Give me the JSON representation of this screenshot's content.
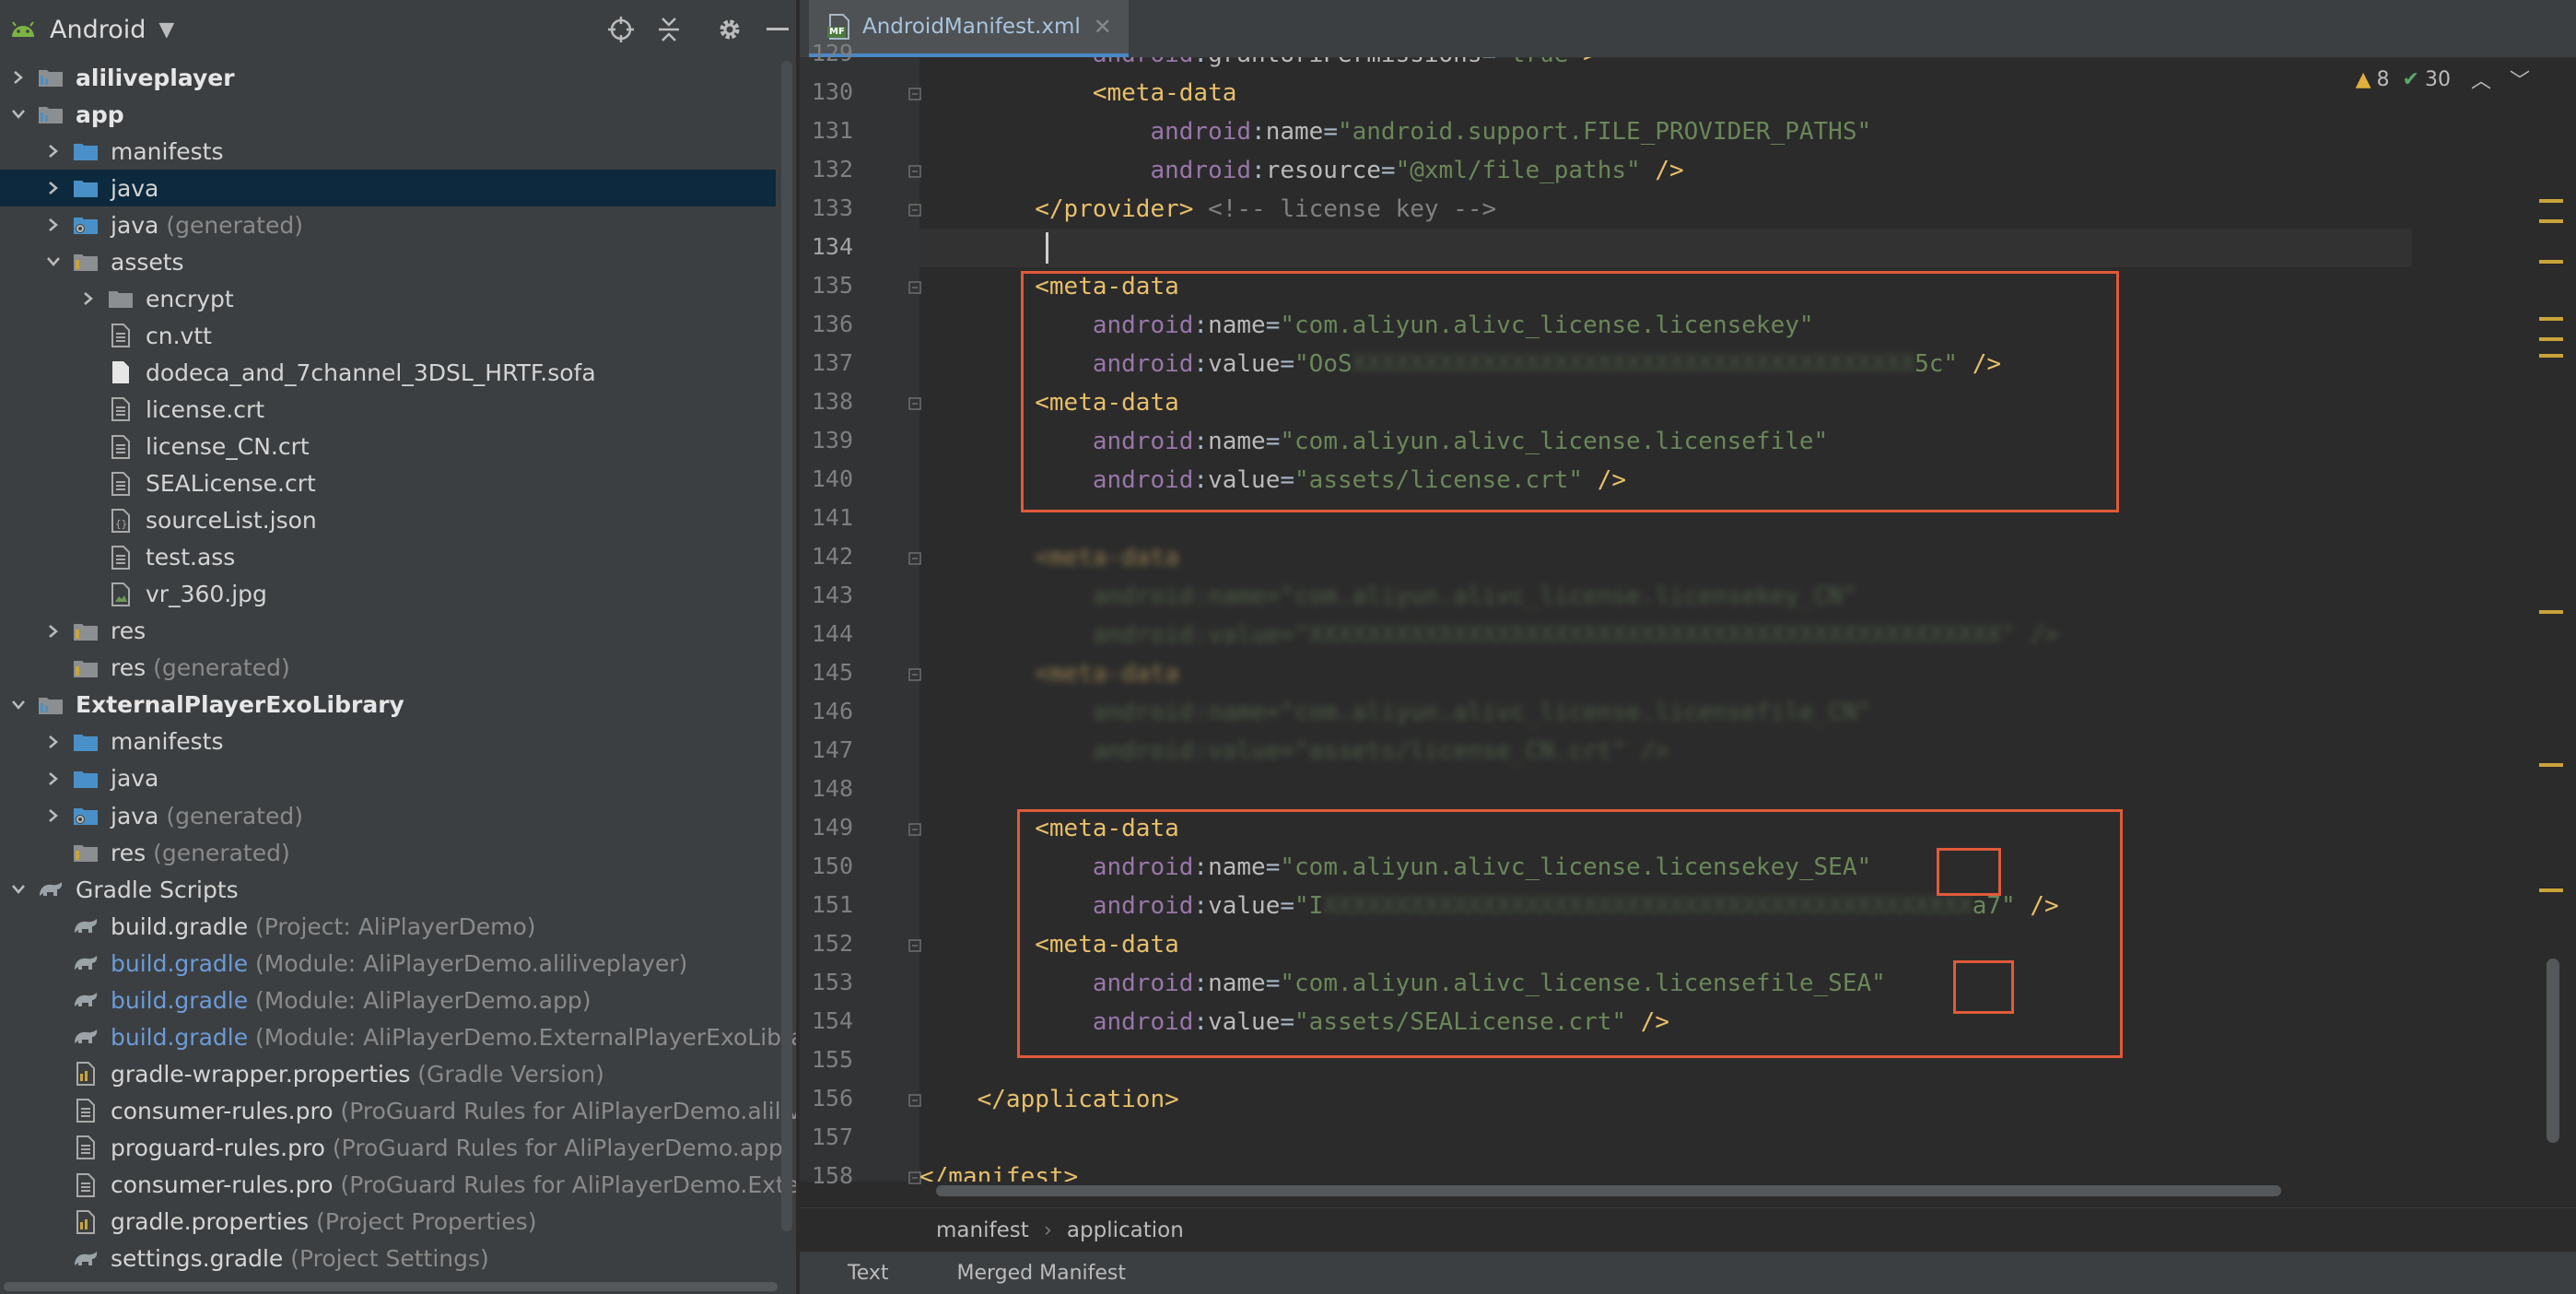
{
  "project_panel": {
    "title": "Android",
    "tree": [
      {
        "label": "aliliveplayer",
        "note": "",
        "depth": 0,
        "arrow": "right",
        "icon": "module-icon",
        "style": "bold"
      },
      {
        "label": "app",
        "note": "",
        "depth": 0,
        "arrow": "down",
        "icon": "module-icon",
        "style": "bold"
      },
      {
        "label": "manifests",
        "note": "",
        "depth": 1,
        "arrow": "right",
        "icon": "folder-blue-icon",
        "style": ""
      },
      {
        "label": "java",
        "note": "",
        "depth": 1,
        "arrow": "right",
        "icon": "folder-blue-icon",
        "style": "",
        "selected": true
      },
      {
        "label": "java",
        "note": "(generated)",
        "depth": 1,
        "arrow": "right",
        "icon": "folder-generated-icon",
        "style": ""
      },
      {
        "label": "assets",
        "note": "",
        "depth": 1,
        "arrow": "down",
        "icon": "folder-assets-icon",
        "style": ""
      },
      {
        "label": "encrypt",
        "note": "",
        "depth": 2,
        "arrow": "right",
        "icon": "folder-icon",
        "style": ""
      },
      {
        "label": "cn.vtt",
        "note": "",
        "depth": 2,
        "arrow": "",
        "icon": "text-file-icon",
        "style": ""
      },
      {
        "label": "dodeca_and_7channel_3DSL_HRTF.sofa",
        "note": "",
        "depth": 2,
        "arrow": "",
        "icon": "blank-file-icon",
        "style": ""
      },
      {
        "label": "license.crt",
        "note": "",
        "depth": 2,
        "arrow": "",
        "icon": "text-file-icon",
        "style": ""
      },
      {
        "label": "license_CN.crt",
        "note": "",
        "depth": 2,
        "arrow": "",
        "icon": "text-file-icon",
        "style": ""
      },
      {
        "label": "SEALicense.crt",
        "note": "",
        "depth": 2,
        "arrow": "",
        "icon": "text-file-icon",
        "style": ""
      },
      {
        "label": "sourceList.json",
        "note": "",
        "depth": 2,
        "arrow": "",
        "icon": "json-file-icon",
        "style": ""
      },
      {
        "label": "test.ass",
        "note": "",
        "depth": 2,
        "arrow": "",
        "icon": "text-file-icon",
        "style": ""
      },
      {
        "label": "vr_360.jpg",
        "note": "",
        "depth": 2,
        "arrow": "",
        "icon": "image-file-icon",
        "style": ""
      },
      {
        "label": "res",
        "note": "",
        "depth": 1,
        "arrow": "right",
        "icon": "folder-res-icon",
        "style": ""
      },
      {
        "label": "res",
        "note": "(generated)",
        "depth": 1,
        "arrow": "",
        "icon": "folder-res-icon",
        "style": ""
      },
      {
        "label": "ExternalPlayerExoLibrary",
        "note": "",
        "depth": 0,
        "arrow": "down",
        "icon": "module-icon",
        "style": "bold"
      },
      {
        "label": "manifests",
        "note": "",
        "depth": 1,
        "arrow": "right",
        "icon": "folder-blue-icon",
        "style": ""
      },
      {
        "label": "java",
        "note": "",
        "depth": 1,
        "arrow": "right",
        "icon": "folder-blue-icon",
        "style": ""
      },
      {
        "label": "java",
        "note": "(generated)",
        "depth": 1,
        "arrow": "right",
        "icon": "folder-generated-icon",
        "style": ""
      },
      {
        "label": "res",
        "note": "(generated)",
        "depth": 1,
        "arrow": "",
        "icon": "folder-res-icon",
        "style": ""
      },
      {
        "label": "Gradle Scripts",
        "note": "",
        "depth": 0,
        "arrow": "down",
        "icon": "gradle-icon",
        "style": ""
      },
      {
        "label": "build.gradle",
        "note": "(Project: AliPlayerDemo)",
        "depth": 1,
        "arrow": "",
        "icon": "gradle-icon",
        "style": ""
      },
      {
        "label": "build.gradle",
        "note": "(Module: AliPlayerDemo.aliliveplayer)",
        "depth": 1,
        "arrow": "",
        "icon": "gradle-icon",
        "style": "blue"
      },
      {
        "label": "build.gradle",
        "note": "(Module: AliPlayerDemo.app)",
        "depth": 1,
        "arrow": "",
        "icon": "gradle-icon",
        "style": "blue"
      },
      {
        "label": "build.gradle",
        "note": "(Module: AliPlayerDemo.ExternalPlayerExoLibrary)",
        "depth": 1,
        "arrow": "",
        "icon": "gradle-icon",
        "style": "blue"
      },
      {
        "label": "gradle-wrapper.properties",
        "note": "(Gradle Version)",
        "depth": 1,
        "arrow": "",
        "icon": "properties-file-icon",
        "style": ""
      },
      {
        "label": "consumer-rules.pro",
        "note": "(ProGuard Rules for AliPlayerDemo.aliliveplaye",
        "depth": 1,
        "arrow": "",
        "icon": "text-file-icon",
        "style": ""
      },
      {
        "label": "proguard-rules.pro",
        "note": "(ProGuard Rules for AliPlayerDemo.app)",
        "depth": 1,
        "arrow": "",
        "icon": "text-file-icon",
        "style": ""
      },
      {
        "label": "consumer-rules.pro",
        "note": "(ProGuard Rules for AliPlayerDemo.ExternalPl",
        "depth": 1,
        "arrow": "",
        "icon": "text-file-icon",
        "style": ""
      },
      {
        "label": "gradle.properties",
        "note": "(Project Properties)",
        "depth": 1,
        "arrow": "",
        "icon": "properties-file-icon",
        "style": ""
      },
      {
        "label": "settings.gradle",
        "note": "(Project Settings)",
        "depth": 1,
        "arrow": "",
        "icon": "gradle-icon",
        "style": ""
      }
    ]
  },
  "editor": {
    "tab": {
      "badge": "MF",
      "label": "AndroidManifest.xml"
    },
    "inspection": {
      "warnings": "8",
      "checks": "30"
    },
    "lines": [
      {
        "n": "129",
        "tokens": [
          [
            "i",
            "            "
          ],
          [
            "ns",
            "android"
          ],
          [
            "plain",
            ":"
          ],
          [
            "attr",
            "grantUriPermissions"
          ],
          [
            "plain",
            "="
          ],
          [
            "val",
            "\"true\""
          ],
          [
            "tag",
            ">"
          ]
        ]
      },
      {
        "n": "130",
        "tokens": [
          [
            "i",
            "            "
          ],
          [
            "tag",
            "<meta-data"
          ]
        ]
      },
      {
        "n": "131",
        "tokens": [
          [
            "i",
            "                "
          ],
          [
            "ns",
            "android"
          ],
          [
            "plain",
            ":"
          ],
          [
            "attr",
            "name"
          ],
          [
            "plain",
            "="
          ],
          [
            "val",
            "\"android.support.FILE_PROVIDER_PATHS\""
          ]
        ]
      },
      {
        "n": "132",
        "tokens": [
          [
            "i",
            "                "
          ],
          [
            "ns",
            "android"
          ],
          [
            "plain",
            ":"
          ],
          [
            "attr",
            "resource"
          ],
          [
            "plain",
            "="
          ],
          [
            "val",
            "\"@xml/file_paths\""
          ],
          [
            "tag",
            " />"
          ]
        ]
      },
      {
        "n": "133",
        "tokens": [
          [
            "i",
            "        "
          ],
          [
            "tag",
            "</provider>"
          ],
          [
            "cmt",
            " <!-- license key -->"
          ]
        ]
      },
      {
        "n": "134",
        "tokens": []
      },
      {
        "n": "135",
        "tokens": [
          [
            "i",
            "        "
          ],
          [
            "tag",
            "<meta-data"
          ]
        ]
      },
      {
        "n": "136",
        "tokens": [
          [
            "i",
            "            "
          ],
          [
            "ns",
            "android"
          ],
          [
            "plain",
            ":"
          ],
          [
            "attr",
            "name"
          ],
          [
            "plain",
            "="
          ],
          [
            "val",
            "\"com.aliyun.alivc_license.licensekey\""
          ]
        ]
      },
      {
        "n": "137",
        "tokens": [
          [
            "i",
            "            "
          ],
          [
            "ns",
            "android"
          ],
          [
            "plain",
            ":"
          ],
          [
            "attr",
            "value"
          ],
          [
            "plain",
            "="
          ],
          [
            "val",
            "\"OoS"
          ],
          [
            "blur",
            "XXXXXXXXXXXXXXXXXXXXXXXXXXXXXXXXXXXXXXX"
          ],
          [
            "val",
            "5c\""
          ],
          [
            "tag",
            " />"
          ]
        ]
      },
      {
        "n": "138",
        "tokens": [
          [
            "i",
            "        "
          ],
          [
            "tag",
            "<meta-data"
          ]
        ]
      },
      {
        "n": "139",
        "tokens": [
          [
            "i",
            "            "
          ],
          [
            "ns",
            "android"
          ],
          [
            "plain",
            ":"
          ],
          [
            "attr",
            "name"
          ],
          [
            "plain",
            "="
          ],
          [
            "val",
            "\"com.aliyun.alivc_license.licensefile\""
          ]
        ]
      },
      {
        "n": "140",
        "tokens": [
          [
            "i",
            "            "
          ],
          [
            "ns",
            "android"
          ],
          [
            "plain",
            ":"
          ],
          [
            "attr",
            "value"
          ],
          [
            "plain",
            "="
          ],
          [
            "val",
            "\"assets/license.crt\""
          ],
          [
            "tag",
            " />"
          ]
        ]
      },
      {
        "n": "141",
        "tokens": []
      },
      {
        "n": "142",
        "tokens": [
          [
            "i",
            "        "
          ],
          [
            "blurtag",
            "<meta-data"
          ]
        ]
      },
      {
        "n": "143",
        "tokens": [
          [
            "i",
            "            "
          ],
          [
            "blur",
            "android:name=\"com.aliyun.alivc_license.licensekey_CN\""
          ]
        ]
      },
      {
        "n": "144",
        "tokens": [
          [
            "i",
            "            "
          ],
          [
            "blur",
            "android:value=\"XXXXXXXXXXXXXXXXXXXXXXXXXXXXXXXXXXXXXXXXXXXXXXXX\" />"
          ]
        ]
      },
      {
        "n": "145",
        "tokens": [
          [
            "i",
            "        "
          ],
          [
            "blurtag",
            "<meta-data"
          ]
        ]
      },
      {
        "n": "146",
        "tokens": [
          [
            "i",
            "            "
          ],
          [
            "blur",
            "android:name=\"com.aliyun.alivc_license.licensefile_CN\""
          ]
        ]
      },
      {
        "n": "147",
        "tokens": [
          [
            "i",
            "            "
          ],
          [
            "blur",
            "android:value=\"assets/license_CN.crt\" />"
          ]
        ]
      },
      {
        "n": "148",
        "tokens": []
      },
      {
        "n": "149",
        "tokens": [
          [
            "i",
            "        "
          ],
          [
            "tag",
            "<meta-data"
          ]
        ]
      },
      {
        "n": "150",
        "tokens": [
          [
            "i",
            "            "
          ],
          [
            "ns",
            "android"
          ],
          [
            "plain",
            ":"
          ],
          [
            "attr",
            "name"
          ],
          [
            "plain",
            "="
          ],
          [
            "val",
            "\"com.aliyun.alivc_license.licensekey_SEA\""
          ]
        ]
      },
      {
        "n": "151",
        "tokens": [
          [
            "i",
            "            "
          ],
          [
            "ns",
            "android"
          ],
          [
            "plain",
            ":"
          ],
          [
            "attr",
            "value"
          ],
          [
            "plain",
            "="
          ],
          [
            "val",
            "\"I"
          ],
          [
            "blur",
            "XXXXXXXXXXXXXXXXXXXXXXXXXXXXXXXXXXXXXXXXXXXXX"
          ],
          [
            "val",
            "a7\""
          ],
          [
            "tag",
            " />"
          ]
        ]
      },
      {
        "n": "152",
        "tokens": [
          [
            "i",
            "        "
          ],
          [
            "tag",
            "<meta-data"
          ]
        ]
      },
      {
        "n": "153",
        "tokens": [
          [
            "i",
            "            "
          ],
          [
            "ns",
            "android"
          ],
          [
            "plain",
            ":"
          ],
          [
            "attr",
            "name"
          ],
          [
            "plain",
            "="
          ],
          [
            "val",
            "\"com.aliyun.alivc_license.licensefile_SEA\""
          ]
        ]
      },
      {
        "n": "154",
        "tokens": [
          [
            "i",
            "            "
          ],
          [
            "ns",
            "android"
          ],
          [
            "plain",
            ":"
          ],
          [
            "attr",
            "value"
          ],
          [
            "plain",
            "="
          ],
          [
            "val",
            "\"assets/SEALicense.crt\""
          ],
          [
            "tag",
            " />"
          ]
        ]
      },
      {
        "n": "155",
        "tokens": []
      },
      {
        "n": "156",
        "tokens": [
          [
            "i",
            "    "
          ],
          [
            "tag",
            "</application>"
          ]
        ]
      },
      {
        "n": "157",
        "tokens": []
      },
      {
        "n": "158",
        "tokens": [
          [
            "tag",
            "</manifest>"
          ]
        ]
      }
    ]
  },
  "breadcrumb": [
    "manifest",
    "application"
  ],
  "bottom_tabs": [
    "Text",
    "Merged Manifest"
  ],
  "colors": {
    "highlight_box": "#e05a3a",
    "selection": "#0d293e",
    "xml_tag": "#e8bf6a",
    "xml_namespace": "#9876aa",
    "xml_value": "#6a8759"
  }
}
